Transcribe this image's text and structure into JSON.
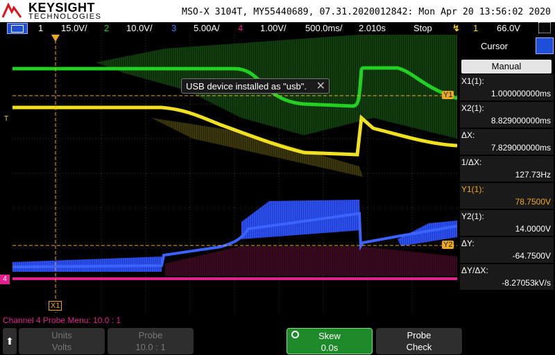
{
  "header": {
    "brand": "KEYSIGHT",
    "brand_sub": "TECHNOLOGIES",
    "scope_id": "MSO-X 3104T, MY55440689, 07.31.2020012842: Mon Apr 20 13:56:02 2020"
  },
  "statusbar": {
    "ch1_num": "1",
    "ch1_scale": "15.0V/",
    "ch2_num": "2",
    "ch2_scale": "10.0V/",
    "ch3_num": "3",
    "ch3_scale": "5.00A/",
    "ch4_num": "4",
    "ch4_scale": "1.00V/",
    "timebase": "500.0ms/",
    "delay": "2.010s",
    "run_state": "Stop",
    "trigger_source": "1",
    "trigger_level": "66.0V"
  },
  "toast": {
    "message": "USB device installed as \"usb\"."
  },
  "markers": {
    "y1": "Y1",
    "y2": "Y2",
    "x1": "X1",
    "ch4_ground": "4"
  },
  "panel": {
    "title": "Cursor",
    "mode": "Manual",
    "rows": [
      {
        "label": "X1(1):",
        "value": "1.000000000ms"
      },
      {
        "label": "X2(1):",
        "value": "8.829000000ms"
      },
      {
        "label": "ΔX:",
        "value": "7.829000000ms"
      },
      {
        "label": "1/ΔX:",
        "value": "127.73Hz"
      },
      {
        "label": "Y1(1):",
        "value": "78.7500V"
      },
      {
        "label": "Y2(1):",
        "value": "14.0000V"
      },
      {
        "label": "ΔY:",
        "value": "-64.7500V"
      },
      {
        "label": "ΔY/ΔX:",
        "value": "-8.27053kV/s"
      }
    ]
  },
  "softkeys": {
    "probe_menu": "Channel 4 Probe Menu: 10.0 : 1",
    "units_label": "Units",
    "units_value": "Volts",
    "probe_label": "Probe",
    "probe_value": "10.0 : 1",
    "skew_label": "Skew",
    "skew_value": "0.0s",
    "check_label": "Probe",
    "check_value": "Check"
  },
  "colors": {
    "ch1": "#f0e020",
    "ch2": "#22d022",
    "ch3": "#2f5fff",
    "ch4": "#e0208c",
    "cursor": "#f1a820",
    "toolbar_blue": "#1e4fd6"
  }
}
